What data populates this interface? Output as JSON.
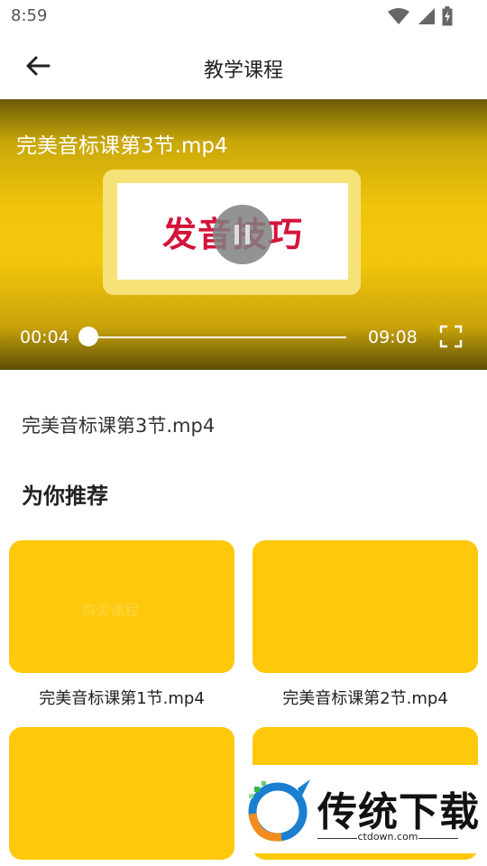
{
  "status_bar": {
    "time": "8:59",
    "icons": [
      "wifi-icon",
      "signal-icon",
      "battery-icon"
    ]
  },
  "header": {
    "title": "教学课程",
    "back_icon": "arrow-left-icon"
  },
  "player": {
    "title": "完美音标课第3节.mp4",
    "slide_text": "发音技巧",
    "current_time": "00:04",
    "total_time": "09:08",
    "progress": 0.007,
    "fullscreen_icon": "fullscreen-icon"
  },
  "content": {
    "title": "完美音标课第3节.mp4"
  },
  "recommend": {
    "title": "为你推荐",
    "items": [
      {
        "label": "完美音标课第1节.mp4",
        "faint_text": "购买课程"
      },
      {
        "label": "完美音标课第2节.mp4"
      },
      {
        "label": ""
      },
      {
        "label": ""
      }
    ]
  },
  "watermark": {
    "name": "传统下载",
    "url": "ctdown.com"
  },
  "colors": {
    "accent_yellow": "#FEC80B",
    "slide_red": "#D4143A",
    "text_dark": "#222222"
  }
}
